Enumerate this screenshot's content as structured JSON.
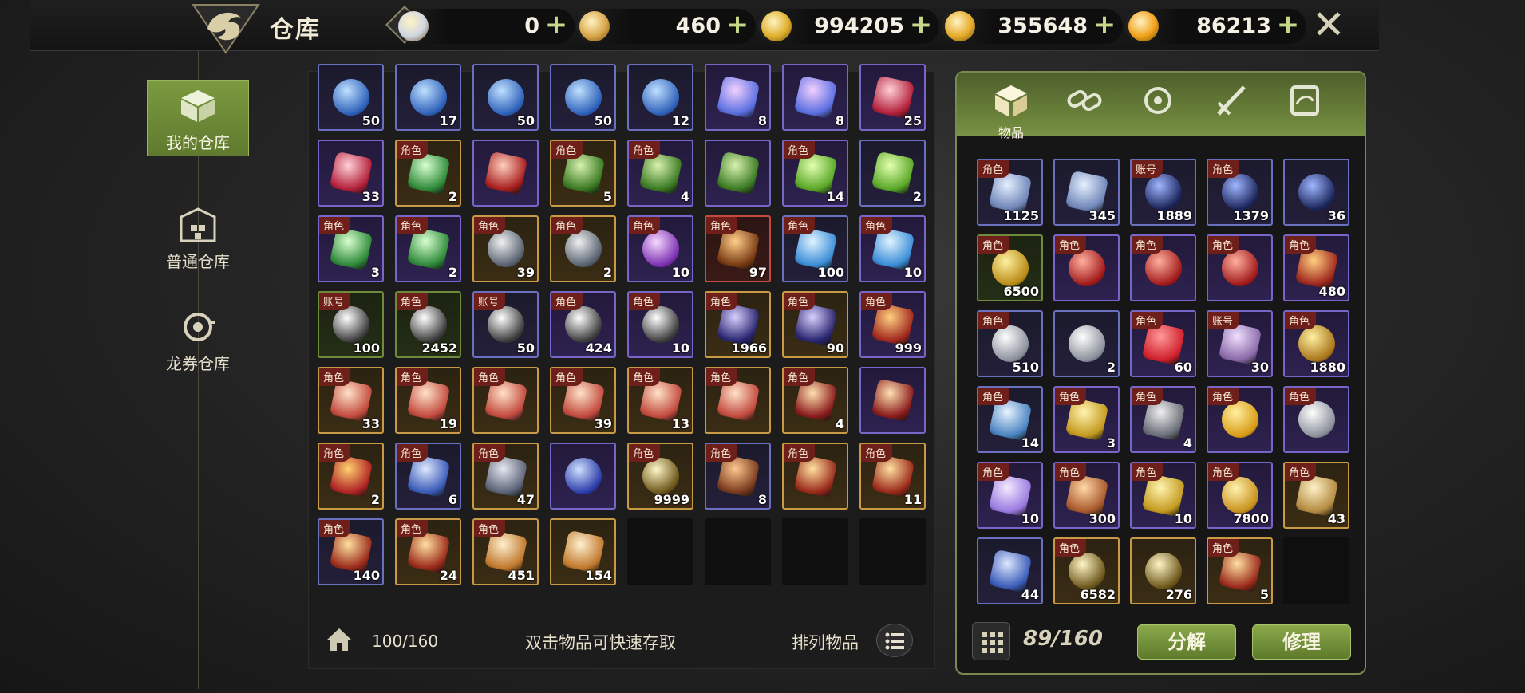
{
  "header": {
    "title": "仓库",
    "help_label": "?",
    "currencies": [
      {
        "name": "card-currency-icon",
        "value": "0",
        "color": "#cfd6e2"
      },
      {
        "name": "ticket-currency-icon",
        "value": "460",
        "color": "#d9a64a"
      },
      {
        "name": "dragon-coin-icon",
        "value": "994205",
        "color": "#e0b02c"
      },
      {
        "name": "gold-coin-icon",
        "value": "355648",
        "color": "#e6ac2a"
      },
      {
        "name": "orange-coin-icon",
        "value": "86213",
        "color": "#f1a21a"
      }
    ],
    "plus": "+",
    "close": "✕"
  },
  "nav": {
    "items": [
      {
        "label": "我的仓库",
        "active": true
      },
      {
        "label": "普通仓库",
        "active": false
      },
      {
        "label": "龙券仓库",
        "active": false
      }
    ]
  },
  "left": {
    "rows": [
      [
        {
          "f": "blue",
          "tag": "",
          "cnt": "50",
          "art": "orb-blue"
        },
        {
          "f": "blue",
          "tag": "",
          "cnt": "17",
          "art": "orb-blue"
        },
        {
          "f": "blue",
          "tag": "",
          "cnt": "50",
          "art": "orb-blue"
        },
        {
          "f": "blue",
          "tag": "",
          "cnt": "50",
          "art": "orb-blue"
        },
        {
          "f": "blue",
          "tag": "",
          "cnt": "12",
          "art": "orb-blue"
        },
        {
          "f": "purple",
          "tag": "",
          "cnt": "8",
          "art": "crystal-rainbow"
        },
        {
          "f": "purple",
          "tag": "",
          "cnt": "8",
          "art": "crystal-rainbow"
        },
        {
          "f": "purple",
          "tag": "",
          "cnt": "25",
          "art": "crystal-red"
        }
      ],
      [
        {
          "f": "purple",
          "tag": "",
          "cnt": "33",
          "art": "crystal-red"
        },
        {
          "f": "gold",
          "tag": "角色",
          "cnt": "2",
          "art": "crystal-green"
        },
        {
          "f": "purple",
          "tag": "",
          "cnt": "",
          "art": "feather-red"
        },
        {
          "f": "gold",
          "tag": "角色",
          "cnt": "5",
          "art": "leaf-green"
        },
        {
          "f": "purple",
          "tag": "角色",
          "cnt": "4",
          "art": "leaf-green"
        },
        {
          "f": "purple",
          "tag": "",
          "cnt": "",
          "art": "leaf-green"
        },
        {
          "f": "purple",
          "tag": "角色",
          "cnt": "14",
          "art": "potion-green"
        },
        {
          "f": "blue",
          "tag": "",
          "cnt": "2",
          "art": "potion-green"
        }
      ],
      [
        {
          "f": "purple",
          "tag": "角色",
          "cnt": "3",
          "art": "crystal-green"
        },
        {
          "f": "purple",
          "tag": "角色",
          "cnt": "2",
          "art": "crystal-green"
        },
        {
          "f": "gold",
          "tag": "角色",
          "cnt": "39",
          "art": "bomb-gray"
        },
        {
          "f": "gold",
          "tag": "角色",
          "cnt": "2",
          "art": "bomb-gray"
        },
        {
          "f": "purple",
          "tag": "角色",
          "cnt": "10",
          "art": "clover-purple"
        },
        {
          "f": "red",
          "tag": "角色",
          "cnt": "97",
          "art": "ore-fire"
        },
        {
          "f": "blue",
          "tag": "角色",
          "cnt": "100",
          "art": "potion-blue"
        },
        {
          "f": "purple",
          "tag": "角色",
          "cnt": "10",
          "art": "potion-blue"
        }
      ],
      [
        {
          "f": "green",
          "tag": "账号",
          "cnt": "100",
          "art": "burst-orb"
        },
        {
          "f": "green",
          "tag": "角色",
          "cnt": "2452",
          "art": "burst-orb"
        },
        {
          "f": "blue",
          "tag": "账号",
          "cnt": "50",
          "art": "burst-orb"
        },
        {
          "f": "purple",
          "tag": "角色",
          "cnt": "424",
          "art": "burst-orb"
        },
        {
          "f": "purple",
          "tag": "角色",
          "cnt": "10",
          "art": "burst-orb"
        },
        {
          "f": "gold",
          "tag": "角色",
          "cnt": "1966",
          "art": "bag-purple"
        },
        {
          "f": "gold",
          "tag": "角色",
          "cnt": "90",
          "art": "bag-purple"
        },
        {
          "f": "purple",
          "tag": "角色",
          "cnt": "999",
          "art": "book-red"
        }
      ],
      [
        {
          "f": "gold",
          "tag": "角色",
          "cnt": "33",
          "art": "card-locked"
        },
        {
          "f": "gold",
          "tag": "角色",
          "cnt": "19",
          "art": "card-locked"
        },
        {
          "f": "gold",
          "tag": "角色",
          "cnt": "",
          "art": "card-locked"
        },
        {
          "f": "gold",
          "tag": "角色",
          "cnt": "39",
          "art": "card-locked"
        },
        {
          "f": "gold",
          "tag": "角色",
          "cnt": "13",
          "art": "card-locked"
        },
        {
          "f": "gold",
          "tag": "角色",
          "cnt": "",
          "art": "card-locked"
        },
        {
          "f": "gold",
          "tag": "角色",
          "cnt": "4",
          "art": "scroll-red"
        },
        {
          "f": "purple",
          "tag": "",
          "cnt": "",
          "art": "scroll-red"
        }
      ],
      [
        {
          "f": "gold",
          "tag": "角色",
          "cnt": "2",
          "art": "firework"
        },
        {
          "f": "blue",
          "tag": "角色",
          "cnt": "6",
          "art": "gift-blue"
        },
        {
          "f": "gold",
          "tag": "角色",
          "cnt": "47",
          "art": "cube-gray"
        },
        {
          "f": "purple",
          "tag": "",
          "cnt": "",
          "art": "portal-blue"
        },
        {
          "f": "gold",
          "tag": "角色",
          "cnt": "9999",
          "art": "burst-gold"
        },
        {
          "f": "blue",
          "tag": "角色",
          "cnt": "8",
          "art": "backpack"
        },
        {
          "f": "gold",
          "tag": "角色",
          "cnt": "",
          "art": "chest-gold"
        },
        {
          "f": "gold",
          "tag": "角色",
          "cnt": "11",
          "art": "chest-gold"
        }
      ],
      [
        {
          "f": "blue",
          "tag": "角色",
          "cnt": "140",
          "art": "chest-gold"
        },
        {
          "f": "gold",
          "tag": "角色",
          "cnt": "24",
          "art": "chest-gold"
        },
        {
          "f": "gold",
          "tag": "角色",
          "cnt": "451",
          "art": "parchment"
        },
        {
          "f": "gold",
          "tag": "",
          "cnt": "154",
          "art": "parchment"
        },
        {
          "f": "empty",
          "tag": "",
          "cnt": "",
          "art": ""
        },
        {
          "f": "empty",
          "tag": "",
          "cnt": "",
          "art": ""
        },
        {
          "f": "empty",
          "tag": "",
          "cnt": "",
          "art": ""
        },
        {
          "f": "empty",
          "tag": "",
          "cnt": "",
          "art": ""
        }
      ]
    ],
    "capacity": "100/160",
    "hint": "双击物品可快速存取",
    "sort_label": "排列物品"
  },
  "right": {
    "tabs": [
      {
        "name": "tab-items",
        "label": "物品",
        "active": true
      },
      {
        "name": "tab-link",
        "label": "",
        "active": false
      },
      {
        "name": "tab-refresh",
        "label": "",
        "active": false
      },
      {
        "name": "tab-weapon",
        "label": "",
        "active": false
      },
      {
        "name": "tab-scroll",
        "label": "",
        "active": false
      }
    ],
    "rows": [
      [
        {
          "f": "blue",
          "tag": "角色",
          "cnt": "1125",
          "art": "crystal-ice"
        },
        {
          "f": "blue",
          "tag": "",
          "cnt": "345",
          "art": "crystal-ice"
        },
        {
          "f": "blue",
          "tag": "账号",
          "cnt": "1889",
          "art": "orb-dark"
        },
        {
          "f": "blue",
          "tag": "角色",
          "cnt": "1379",
          "art": "orb-dark"
        },
        {
          "f": "blue",
          "tag": "",
          "cnt": "36",
          "art": "orb-dark"
        }
      ],
      [
        {
          "f": "green",
          "tag": "角色",
          "cnt": "6500",
          "art": "medal-gold"
        },
        {
          "f": "purple",
          "tag": "角色",
          "cnt": "",
          "art": "emblem-red"
        },
        {
          "f": "purple",
          "tag": "角色",
          "cnt": "",
          "art": "emblem-red"
        },
        {
          "f": "purple",
          "tag": "角色",
          "cnt": "",
          "art": "emblem-red"
        },
        {
          "f": "purple",
          "tag": "角色",
          "cnt": "480",
          "art": "book-red"
        }
      ],
      [
        {
          "f": "blue",
          "tag": "角色",
          "cnt": "510",
          "art": "orb-white"
        },
        {
          "f": "blue",
          "tag": "",
          "cnt": "2",
          "art": "orb-white"
        },
        {
          "f": "purple",
          "tag": "角色",
          "cnt": "60",
          "art": "heart-red"
        },
        {
          "f": "purple",
          "tag": "账号",
          "cnt": "30",
          "art": "scroll-purple"
        },
        {
          "f": "purple",
          "tag": "角色",
          "cnt": "1880",
          "art": "gear-gold"
        }
      ],
      [
        {
          "f": "blue",
          "tag": "角色",
          "cnt": "14",
          "art": "map-blue"
        },
        {
          "f": "purple",
          "tag": "角色",
          "cnt": "3",
          "art": "ticket-gold"
        },
        {
          "f": "purple",
          "tag": "角色",
          "cnt": "4",
          "art": "ticket-gray"
        },
        {
          "f": "purple",
          "tag": "角色",
          "cnt": "",
          "art": "cart-coin"
        },
        {
          "f": "purple",
          "tag": "角色",
          "cnt": "",
          "art": "orb-white"
        }
      ],
      [
        {
          "f": "purple",
          "tag": "角色",
          "cnt": "10",
          "art": "gem-violet"
        },
        {
          "f": "purple",
          "tag": "角色",
          "cnt": "300",
          "art": "gingerbread"
        },
        {
          "f": "purple",
          "tag": "角色",
          "cnt": "10",
          "art": "ticket-gold"
        },
        {
          "f": "purple",
          "tag": "角色",
          "cnt": "7800",
          "art": "coin-gold"
        },
        {
          "f": "gold",
          "tag": "角色",
          "cnt": "43",
          "art": "scroll-gold"
        }
      ],
      [
        {
          "f": "blue",
          "tag": "",
          "cnt": "44",
          "art": "gift-blue"
        },
        {
          "f": "gold",
          "tag": "角色",
          "cnt": "6582",
          "art": "burst-gold"
        },
        {
          "f": "gold",
          "tag": "",
          "cnt": "276",
          "art": "burst-gold"
        },
        {
          "f": "gold",
          "tag": "角色",
          "cnt": "5",
          "art": "chest-gold"
        },
        {
          "f": "empty",
          "tag": "",
          "cnt": "",
          "art": ""
        }
      ]
    ],
    "capacity": "89/160",
    "decompose_label": "分解",
    "repair_label": "修理"
  }
}
